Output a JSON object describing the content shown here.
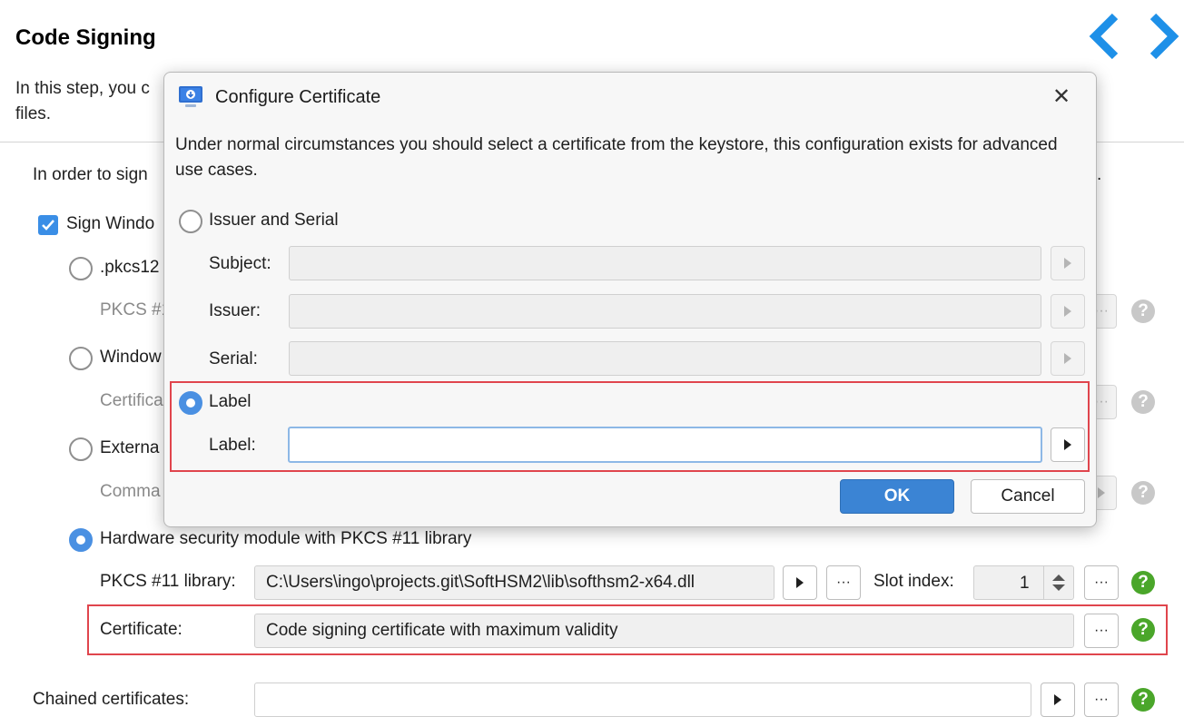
{
  "page": {
    "title": "Code Signing",
    "intro_visible": "In this step, you c",
    "intro_line2": "files.",
    "info_text": "In order to sign",
    "info_tail": ".",
    "sign_windows_label": "Sign Windo",
    "pkcs12_label": ".pkcs12",
    "pkcs12_sub_label": "PKCS #1",
    "windows_label": "Window",
    "windows_sub_label": "Certifica",
    "external_label": "Externa",
    "external_sub_label": "Comma",
    "hsm_label": "Hardware security module with PKCS #11 library",
    "pkcs11_library_label": "PKCS #11 library:",
    "pkcs11_library_value": "C:\\Users\\ingo\\projects.git\\SoftHSM2\\lib\\softhsm2-x64.dll",
    "slot_index_label": "Slot index:",
    "slot_index_value": "1",
    "certificate_label": "Certificate:",
    "certificate_value": "Code signing certificate with maximum validity",
    "chained_label": "Chained certificates:",
    "ellipsis": "···",
    "help_glyph": "?"
  },
  "dialog": {
    "title": "Configure Certificate",
    "description": "Under normal circumstances you should select a certificate from the keystore, this configuration exists for advanced use cases.",
    "option_issuer_serial": "Issuer and Serial",
    "subject_label": "Subject:",
    "issuer_label": "Issuer:",
    "serial_label": "Serial:",
    "option_label": "Label",
    "label_field_label": "Label:",
    "label_value": "",
    "ok_label": "OK",
    "cancel_label": "Cancel",
    "close_glyph": "✕"
  },
  "colors": {
    "accent": "#3b84d4",
    "help_green": "#4aa62a",
    "highlight_red": "#e0454d",
    "nav_blue": "#1e90e8"
  }
}
